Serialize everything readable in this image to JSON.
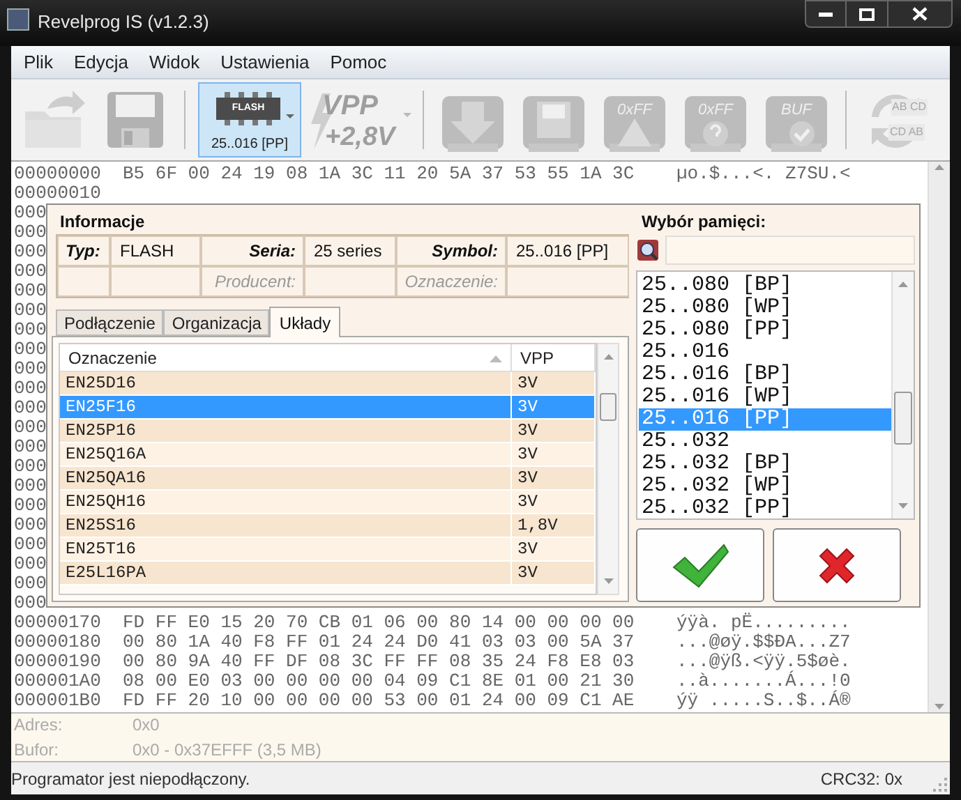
{
  "window": {
    "title": "Revelprog IS (v1.2.3)"
  },
  "menu": [
    "Plik",
    "Edycja",
    "Widok",
    "Ustawienia",
    "Pomoc"
  ],
  "toolbar": [
    {
      "kind": "open",
      "disabled": true
    },
    {
      "kind": "save",
      "disabled": true
    },
    {
      "kind": "separator"
    },
    {
      "kind": "chip",
      "label": "FLASH",
      "caption": "25..016 [PP]",
      "disabled": false
    },
    {
      "kind": "vpp",
      "label": "VPP",
      "caption": "+2,8V",
      "disabled": true
    },
    {
      "kind": "separator"
    },
    {
      "kind": "read",
      "disabled": true
    },
    {
      "kind": "write",
      "disabled": true
    },
    {
      "kind": "erase",
      "label": "0xFF",
      "disabled": true
    },
    {
      "kind": "blank",
      "label": "0xFF",
      "disabled": true
    },
    {
      "kind": "verify",
      "label": "BUF",
      "disabled": true
    },
    {
      "kind": "separator"
    },
    {
      "kind": "compare",
      "label": "AB CD",
      "caption": "CD AB",
      "disabled": true
    }
  ],
  "hex_rows": [
    {
      "address": "00000000",
      "bytes": "B5 6F 00 24 19 08 1A 3C 11 20 5A 37 53 55 1A 3C",
      "ascii": "µo.$...<. Z7SU.<"
    },
    {
      "address": "00000010"
    },
    {
      "address": "000"
    },
    {
      "address": "000"
    },
    {
      "address": "000"
    },
    {
      "address": "000"
    },
    {
      "address": "000"
    },
    {
      "address": "000"
    },
    {
      "address": "000"
    },
    {
      "address": "000"
    },
    {
      "address": "000"
    },
    {
      "address": "000"
    },
    {
      "address": "000"
    },
    {
      "address": "000"
    },
    {
      "address": "000"
    },
    {
      "address": "000"
    },
    {
      "address": "000"
    },
    {
      "address": "000"
    },
    {
      "address": "000"
    },
    {
      "address": "000"
    },
    {
      "address": "000"
    },
    {
      "address": "000"
    },
    {
      "address": "000"
    },
    {
      "address": "00000170",
      "bytes": "FD FF E0 15 20 70 CB 01 06 00 80 14 00 00 00 00",
      "ascii": "ýÿà. pË........."
    },
    {
      "address": "00000180",
      "bytes": "00 80 1A 40 F8 FF 01 24 24 D0 41 03 03 00 5A 37",
      "ascii": "...@øÿ.$$ÐA...Z7"
    },
    {
      "address": "00000190",
      "bytes": "00 80 9A 40 FF DF 08 3C FF FF 08 35 24 F8 E8 03",
      "ascii": "...@ÿß.<ÿÿ.5$øè."
    },
    {
      "address": "000001A0",
      "bytes": "08 00 E0 03 00 00 00 00 04 09 C1 8E 01 00 21 30",
      "ascii": "..à.......Á...!0"
    },
    {
      "address": "000001B0",
      "bytes": "FD FF 20 10 00 00 00 00 53 00 01 24 00 09 C1 AE",
      "ascii": "ýÿ .....S..$..Á®"
    }
  ],
  "chip_dialog": {
    "info_title": "Informacje",
    "info_rows": [
      [
        {
          "label": "Typ:",
          "value": "FLASH",
          "disabled": false
        },
        {
          "label": "Seria:",
          "value": "25 series",
          "disabled": false
        },
        {
          "label": "Symbol:",
          "value": "25..016 [PP]",
          "disabled": false
        }
      ],
      [
        {},
        {
          "label": "Producent:",
          "disabled": true
        },
        {
          "label": "Oznaczenie:",
          "disabled": true
        }
      ]
    ],
    "tabs": [
      {
        "label": "Podłączenie",
        "selected": false
      },
      {
        "label": "Organizacja",
        "selected": false
      },
      {
        "label": "Układy",
        "selected": true
      }
    ],
    "chip_table": {
      "columns": [
        {
          "label": "Oznaczenie",
          "sorted": true
        },
        {
          "label": "VPP",
          "sorted": false
        }
      ],
      "rows": [
        {
          "cells": [
            "EN25D16",
            "3V"
          ],
          "selected": false
        },
        {
          "cells": [
            "EN25F16",
            "3V"
          ],
          "selected": true
        },
        {
          "cells": [
            "EN25P16",
            "3V"
          ],
          "selected": false
        },
        {
          "cells": [
            "EN25Q16A",
            "3V"
          ],
          "selected": false
        },
        {
          "cells": [
            "EN25QA16",
            "3V"
          ],
          "selected": false
        },
        {
          "cells": [
            "EN25QH16",
            "3V"
          ],
          "selected": false
        },
        {
          "cells": [
            "EN25S16",
            "1,8V"
          ],
          "selected": false
        },
        {
          "cells": [
            "EN25T16",
            "3V"
          ],
          "selected": false
        },
        {
          "cells": [
            "E25L16PA",
            "3V"
          ],
          "selected": false
        }
      ]
    },
    "memory_title": "Wybór pamięci:",
    "memory_list": [
      {
        "label": "25..080 [BP]",
        "selected": false
      },
      {
        "label": "25..080 [WP]",
        "selected": false
      },
      {
        "label": "25..080 [PP]",
        "selected": false
      },
      {
        "label": "25..016",
        "selected": false
      },
      {
        "label": "25..016 [BP]",
        "selected": false
      },
      {
        "label": "25..016 [WP]",
        "selected": false
      },
      {
        "label": "25..016 [PP]",
        "selected": true
      },
      {
        "label": "25..032",
        "selected": false
      },
      {
        "label": "25..032 [BP]",
        "selected": false
      },
      {
        "label": "25..032 [WP]",
        "selected": false
      },
      {
        "label": "25..032 [PP]",
        "selected": false
      }
    ],
    "buttons": [
      {
        "kind": "ok"
      },
      {
        "kind": "cancel"
      }
    ]
  },
  "info_panel": [
    {
      "label": "Adres:",
      "value": "0x0"
    },
    {
      "label": "Bufor:",
      "value": "0x0 - 0x37EFFF (3,5 MB)"
    }
  ],
  "status_bar": {
    "message": "Programator jest niepodłączony.",
    "crc": "CRC32: 0x"
  }
}
